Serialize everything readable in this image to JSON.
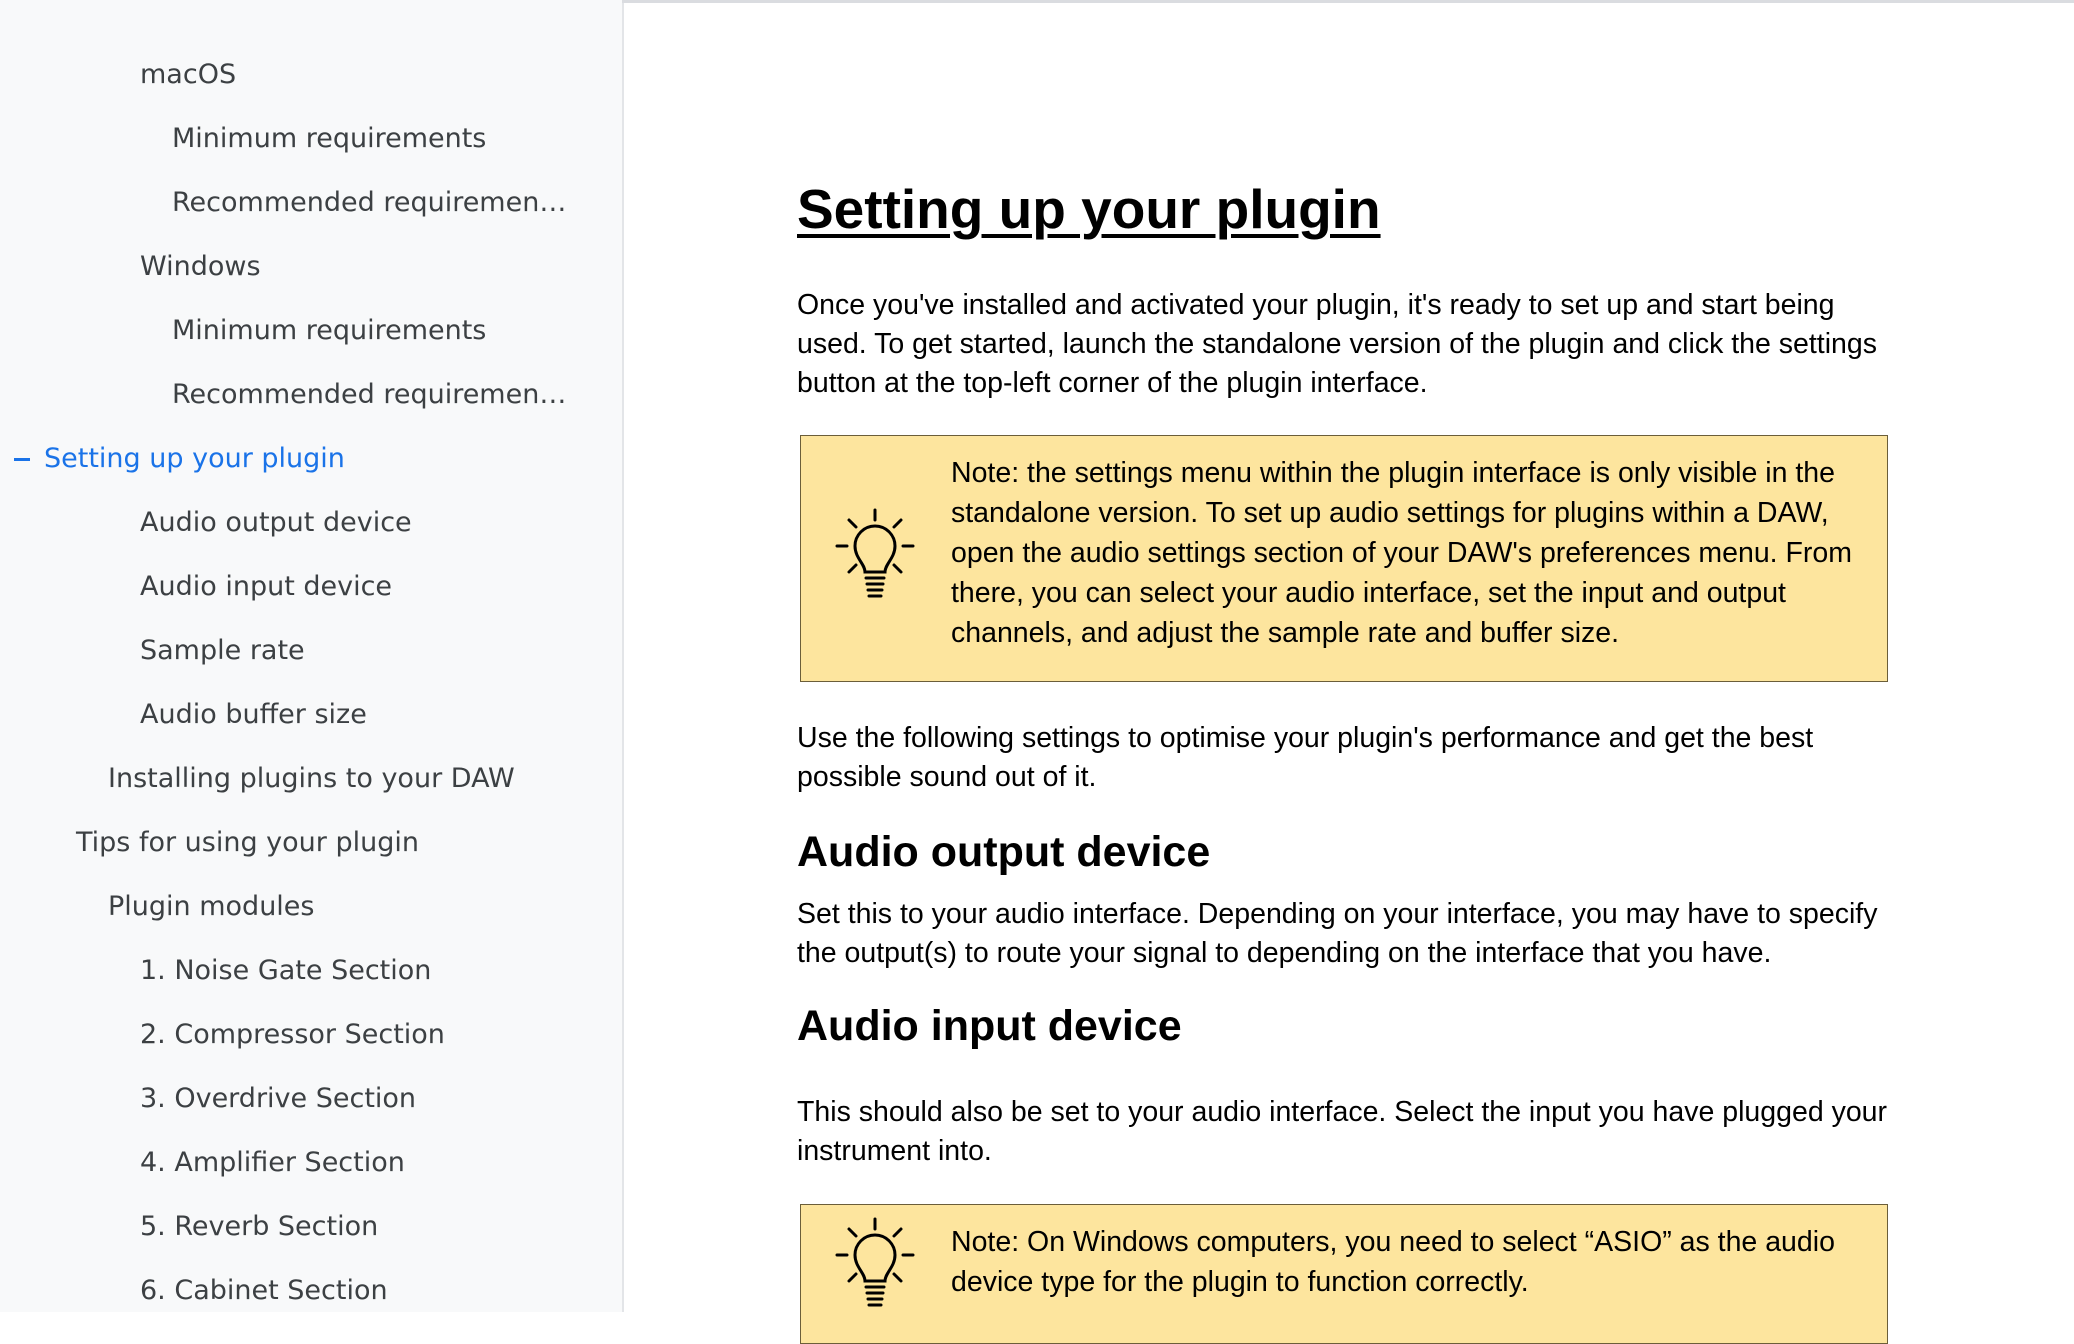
{
  "outline": {
    "items": [
      {
        "label": "macOS",
        "indent": 3
      },
      {
        "label": "Minimum requirements",
        "indent": 4
      },
      {
        "label": "Recommended requiremen…",
        "indent": 4
      },
      {
        "label": "Windows",
        "indent": 3
      },
      {
        "label": "Minimum requirements",
        "indent": 4
      },
      {
        "label": "Recommended requiremen…",
        "indent": 4
      },
      {
        "label": "Setting up your plugin",
        "indent": 0,
        "active": true
      },
      {
        "label": "Audio output device",
        "indent": 3
      },
      {
        "label": "Audio input device",
        "indent": 3
      },
      {
        "label": "Sample rate",
        "indent": 3
      },
      {
        "label": "Audio buffer size",
        "indent": 3
      },
      {
        "label": "Installing plugins to your DAW",
        "indent": 2
      },
      {
        "label": "Tips for using your plugin",
        "indent": 1
      },
      {
        "label": "Plugin modules",
        "indent": 2
      },
      {
        "label": "1. Noise Gate Section",
        "indent": 3
      },
      {
        "label": "2. Compressor Section",
        "indent": 3
      },
      {
        "label": "3. Overdrive Section",
        "indent": 3
      },
      {
        "label": "4. Amplifier Section",
        "indent": 3
      },
      {
        "label": "5. Reverb Section",
        "indent": 3
      },
      {
        "label": "6. Cabinet Section",
        "indent": 3
      }
    ],
    "active_color": "#1a73e8"
  },
  "document": {
    "title": "Setting up your plugin",
    "intro": "Once you've installed and activated your plugin, it's ready to set up and start being used. To get started, launch the standalone version of the plugin and click the settings button at the top-left corner of the plugin interface.",
    "note1": "Note: the settings menu within the plugin interface is only visible in the standalone version. To set up audio settings for plugins within a DAW, open the audio settings section of your DAW's preferences menu. From there, you can select your audio interface, set the input and output channels, and adjust the sample rate and buffer size.",
    "para2": "Use the following settings to optimise your plugin's performance and get the best possible sound out of it.",
    "h_output": "Audio output device",
    "output_text": "Set this to your audio interface. Depending on your interface, you may have to specify the output(s) to route your signal to depending on the interface that you have.",
    "h_input": "Audio input device",
    "input_text": "This should also be set to your audio interface. Select the input you have plugged your instrument into.",
    "note2": "Note: On Windows computers, you need to select “ASIO” as the audio device type for the plugin to function correctly.",
    "callout_color": "#fde59e"
  }
}
